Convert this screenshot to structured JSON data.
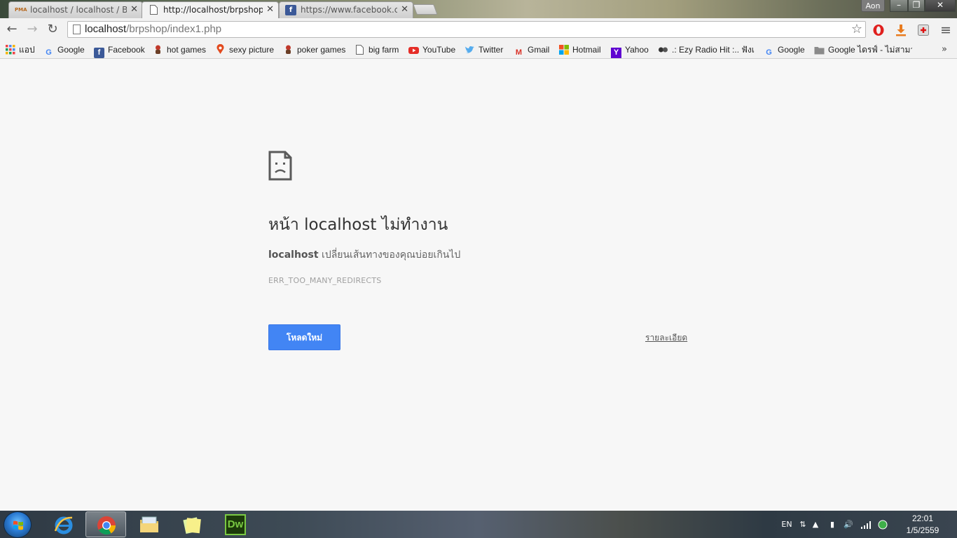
{
  "tabs": [
    {
      "title": "localhost / localhost / Bur",
      "icon": "phpmyadmin-icon",
      "icon_text": "PMA",
      "active": false
    },
    {
      "title": "http://localhost/brpshop/i",
      "icon": "page-icon",
      "active": true
    },
    {
      "title": "https://www.facebook.com",
      "icon": "facebook-icon",
      "icon_text": "f",
      "active": false
    }
  ],
  "window": {
    "profile_name": "Aon",
    "minimize": "–",
    "maximize": "❐",
    "close": "✕"
  },
  "toolbar": {
    "back": "←",
    "forward": "→",
    "reload": "↻",
    "url_host": "localhost",
    "url_path": "/brpshop/index1.php",
    "star": "☆",
    "menu": "≡"
  },
  "bookmarks": [
    {
      "label": "แอป",
      "icon": "apps-grid-icon"
    },
    {
      "label": "Google",
      "icon": "google-icon",
      "icon_text": "G"
    },
    {
      "label": "Facebook",
      "icon": "facebook-icon",
      "icon_text": "f"
    },
    {
      "label": "hot games",
      "icon": "game-icon"
    },
    {
      "label": "sexy picture",
      "icon": "pin-icon"
    },
    {
      "label": "poker games",
      "icon": "game-icon"
    },
    {
      "label": "big farm",
      "icon": "page-icon"
    },
    {
      "label": "YouTube",
      "icon": "youtube-icon"
    },
    {
      "label": "Twitter",
      "icon": "twitter-icon"
    },
    {
      "label": "Gmail",
      "icon": "gmail-icon",
      "icon_text": "M"
    },
    {
      "label": "Hotmail",
      "icon": "windows-logo-icon"
    },
    {
      "label": "Yahoo",
      "icon": "yahoo-icon",
      "icon_text": "Y"
    },
    {
      "label": ".: Ezy Radio Hit :.. ฟังเ",
      "icon": "radio-icon"
    },
    {
      "label": "Google",
      "icon": "google-icon",
      "icon_text": "G"
    },
    {
      "label": "Google ไดรฟ์ - ไม่สามา",
      "icon": "folder-icon"
    }
  ],
  "bookmarks_more": "»",
  "error_page": {
    "heading": "หน้า localhost ไม่ทำงาน",
    "host": "localhost",
    "message": " เปลี่ยนเส้นทางของคุณบ่อยเกินไป",
    "code": "ERR_TOO_MANY_REDIRECTS",
    "reload_label": "โหลดใหม่",
    "details_label": "รายละเอียด"
  },
  "taskbar": {
    "apps": [
      {
        "name": "internet-explorer"
      },
      {
        "name": "chrome",
        "active": true
      },
      {
        "name": "file-explorer"
      },
      {
        "name": "sticky-notes"
      },
      {
        "name": "dreamweaver",
        "label": "Dw"
      }
    ],
    "lang": "EN",
    "time": "22:01",
    "date": "1/5/2559"
  },
  "colors": {
    "accent": "#4285f4",
    "page_bg": "#f7f7f7",
    "text": "#333333"
  }
}
